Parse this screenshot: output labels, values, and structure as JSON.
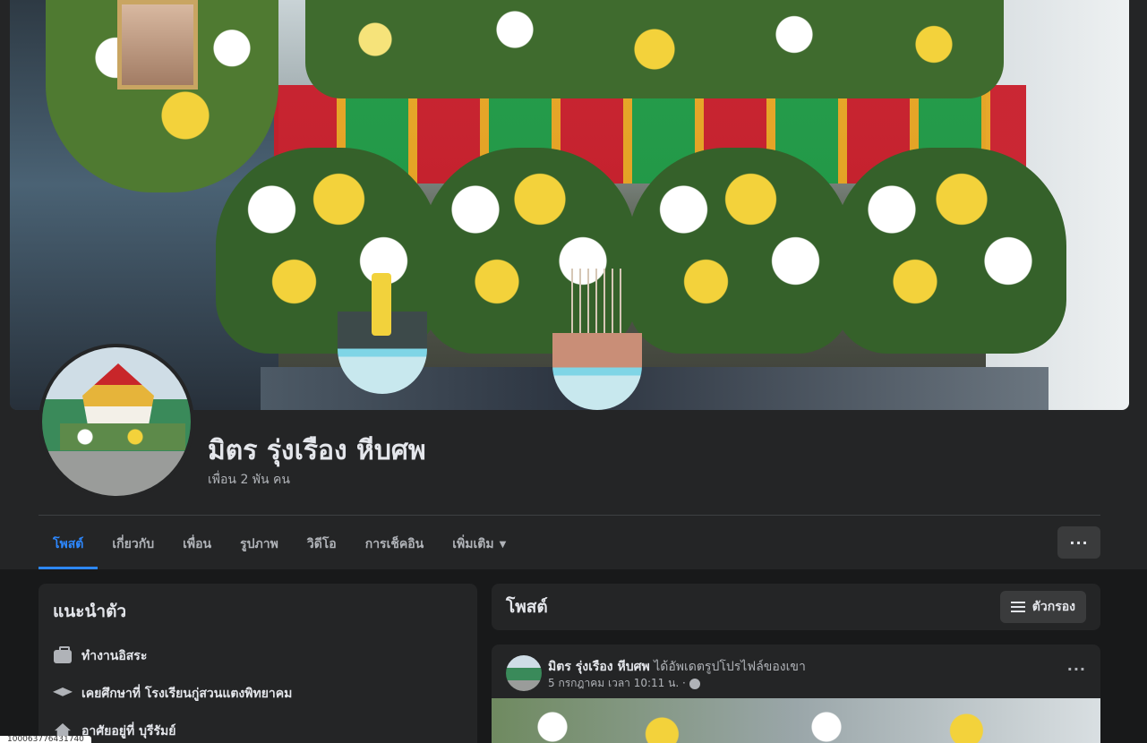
{
  "profile": {
    "name": "มิตร รุ่งเรือง หีบศพ",
    "friends": "เพื่อน 2 พัน คน"
  },
  "tabs": [
    {
      "label": "โพสต์",
      "active": true
    },
    {
      "label": "เกี่ยวกับ"
    },
    {
      "label": "เพื่อน"
    },
    {
      "label": "รูปภาพ"
    },
    {
      "label": "วิดีโอ"
    },
    {
      "label": "การเช็คอิน"
    },
    {
      "label": "เพิ่มเติม"
    }
  ],
  "more_button": "···",
  "intro": {
    "title": "แนะนำตัว",
    "items": [
      {
        "icon": "briefcase-icon",
        "text": "ทำงานอิสระ"
      },
      {
        "icon": "graduation-cap-icon",
        "text": "เคยศึกษาที่ โรงเรียนกู่สวนแตงพิทยาคม"
      },
      {
        "icon": "home-icon",
        "text": "อาศัยอยู่ที่ บุรีรัมย์"
      }
    ]
  },
  "posts": {
    "title": "โพสต์",
    "filter_label": "ตัวกรอง"
  },
  "post": {
    "author": "มิตร รุ่งเรือง หีบศพ",
    "action": "ได้อัพเดตรูปโปรไฟล์ของเขา",
    "date": "5 กรกฎาคม เวลา 10:11 น. ·",
    "menu": "···"
  },
  "status_bar": "100063776431740",
  "colors": {
    "accent": "#2d88ff",
    "surface": "#242526",
    "background": "#18191a"
  }
}
